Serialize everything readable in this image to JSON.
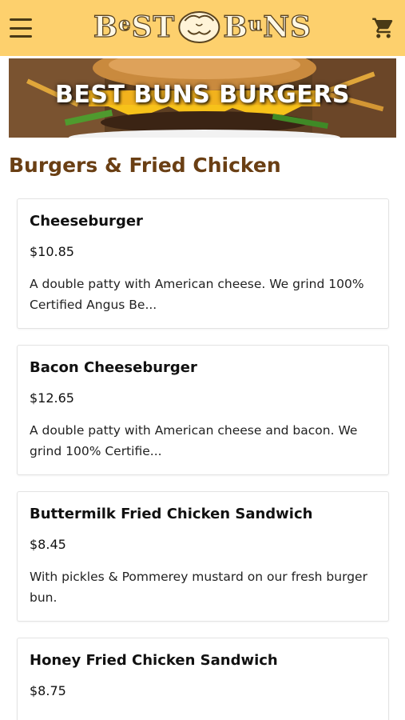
{
  "header": {
    "logo": {
      "left": "BeST",
      "right": "BuNS"
    },
    "menu_icon": "hamburger-menu-icon",
    "cart_icon": "shopping-cart-icon",
    "background_color": "#fdd06d"
  },
  "hero": {
    "title": "BEST BUNS BURGERS"
  },
  "section": {
    "title": "Burgers & Fried Chicken",
    "title_color": "#6a3f14"
  },
  "menu_items": [
    {
      "name": "Cheeseburger",
      "price": "$10.85",
      "description": "A double patty with American cheese. We grind 100% Certified Angus Be..."
    },
    {
      "name": "Bacon Cheeseburger",
      "price": "$12.65",
      "description": "A double patty with American cheese and bacon. We grind 100% Certifie..."
    },
    {
      "name": "Buttermilk Fried Chicken Sandwich",
      "price": "$8.45",
      "description": "With pickles & Pommerey mustard on our fresh burger bun."
    },
    {
      "name": "Honey Fried Chicken Sandwich",
      "price": "$8.75",
      "description": ""
    }
  ]
}
